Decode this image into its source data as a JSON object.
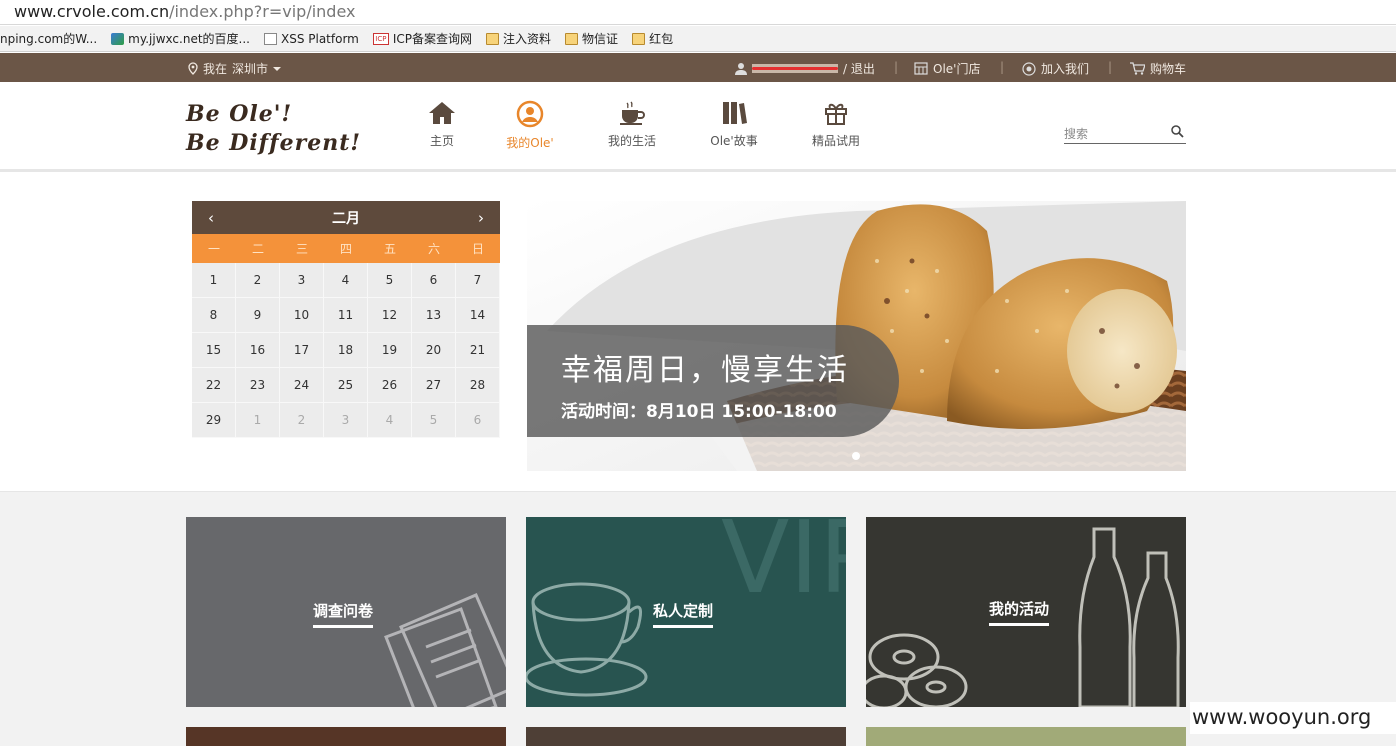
{
  "browser": {
    "url_host": "www.crvole.com.cn",
    "url_path": "/index.php?r=vip/index",
    "bookmarks": [
      {
        "label": "nping.com的W...",
        "icon": "page-icon"
      },
      {
        "label": "my.jjwxc.net的百度...",
        "icon": "site-logo-icon"
      },
      {
        "label": "XSS Platform",
        "icon": "page-icon"
      },
      {
        "label": "ICP备案查询网",
        "icon": "icp-icon"
      },
      {
        "label": "注入资料",
        "icon": "folder-icon"
      },
      {
        "label": "物信证",
        "icon": "folder-icon"
      },
      {
        "label": "红包",
        "icon": "folder-icon"
      }
    ]
  },
  "topbar": {
    "location_prefix": "我在",
    "city": "深圳市",
    "logout": "/ 退出",
    "store": "Ole'门店",
    "join": "加入我们",
    "cart": "购物车",
    "separator": "|"
  },
  "header": {
    "logo_line1": "Be Ole'!",
    "logo_line2": "Be Different!",
    "nav": [
      {
        "label": "主页",
        "icon": "home-icon",
        "active": false
      },
      {
        "label": "我的Ole'",
        "icon": "user-circle-icon",
        "active": true
      },
      {
        "label": "我的生活",
        "icon": "coffee-cup-icon",
        "active": false
      },
      {
        "label": "Ole'故事",
        "icon": "books-icon",
        "active": false
      },
      {
        "label": "精品试用",
        "icon": "gift-icon",
        "active": false
      }
    ],
    "search_placeholder": "搜索"
  },
  "calendar": {
    "month": "二月",
    "prev": "‹",
    "next": "›",
    "weekdays": [
      "一",
      "二",
      "三",
      "四",
      "五",
      "六",
      "日"
    ],
    "days": [
      "1",
      "2",
      "3",
      "4",
      "5",
      "6",
      "7",
      "8",
      "9",
      "10",
      "11",
      "12",
      "13",
      "14",
      "15",
      "16",
      "17",
      "18",
      "19",
      "20",
      "21",
      "22",
      "23",
      "24",
      "25",
      "26",
      "27",
      "28",
      "29",
      "1",
      "2",
      "3",
      "4",
      "5",
      "6"
    ],
    "other_month_from_index": 29
  },
  "banner": {
    "headline": "幸福周日，慢享生活",
    "subline": "活动时间：8月10日 15:00-18:00"
  },
  "tiles": [
    {
      "label": "调查问卷",
      "color": "#67686b"
    },
    {
      "label": "私人定制",
      "color": "#285450"
    },
    {
      "label": "我的活动",
      "color": "#363631"
    }
  ],
  "strip_colors": [
    "#563526",
    "#4e3f36",
    "#a1aa78"
  ],
  "colors": {
    "topbar": "#6b5647",
    "accent": "#e8862b",
    "calendar_header": "#5e4a3c",
    "calendar_weekdays": "#f4923a"
  },
  "watermark": "www.wooyun.org"
}
